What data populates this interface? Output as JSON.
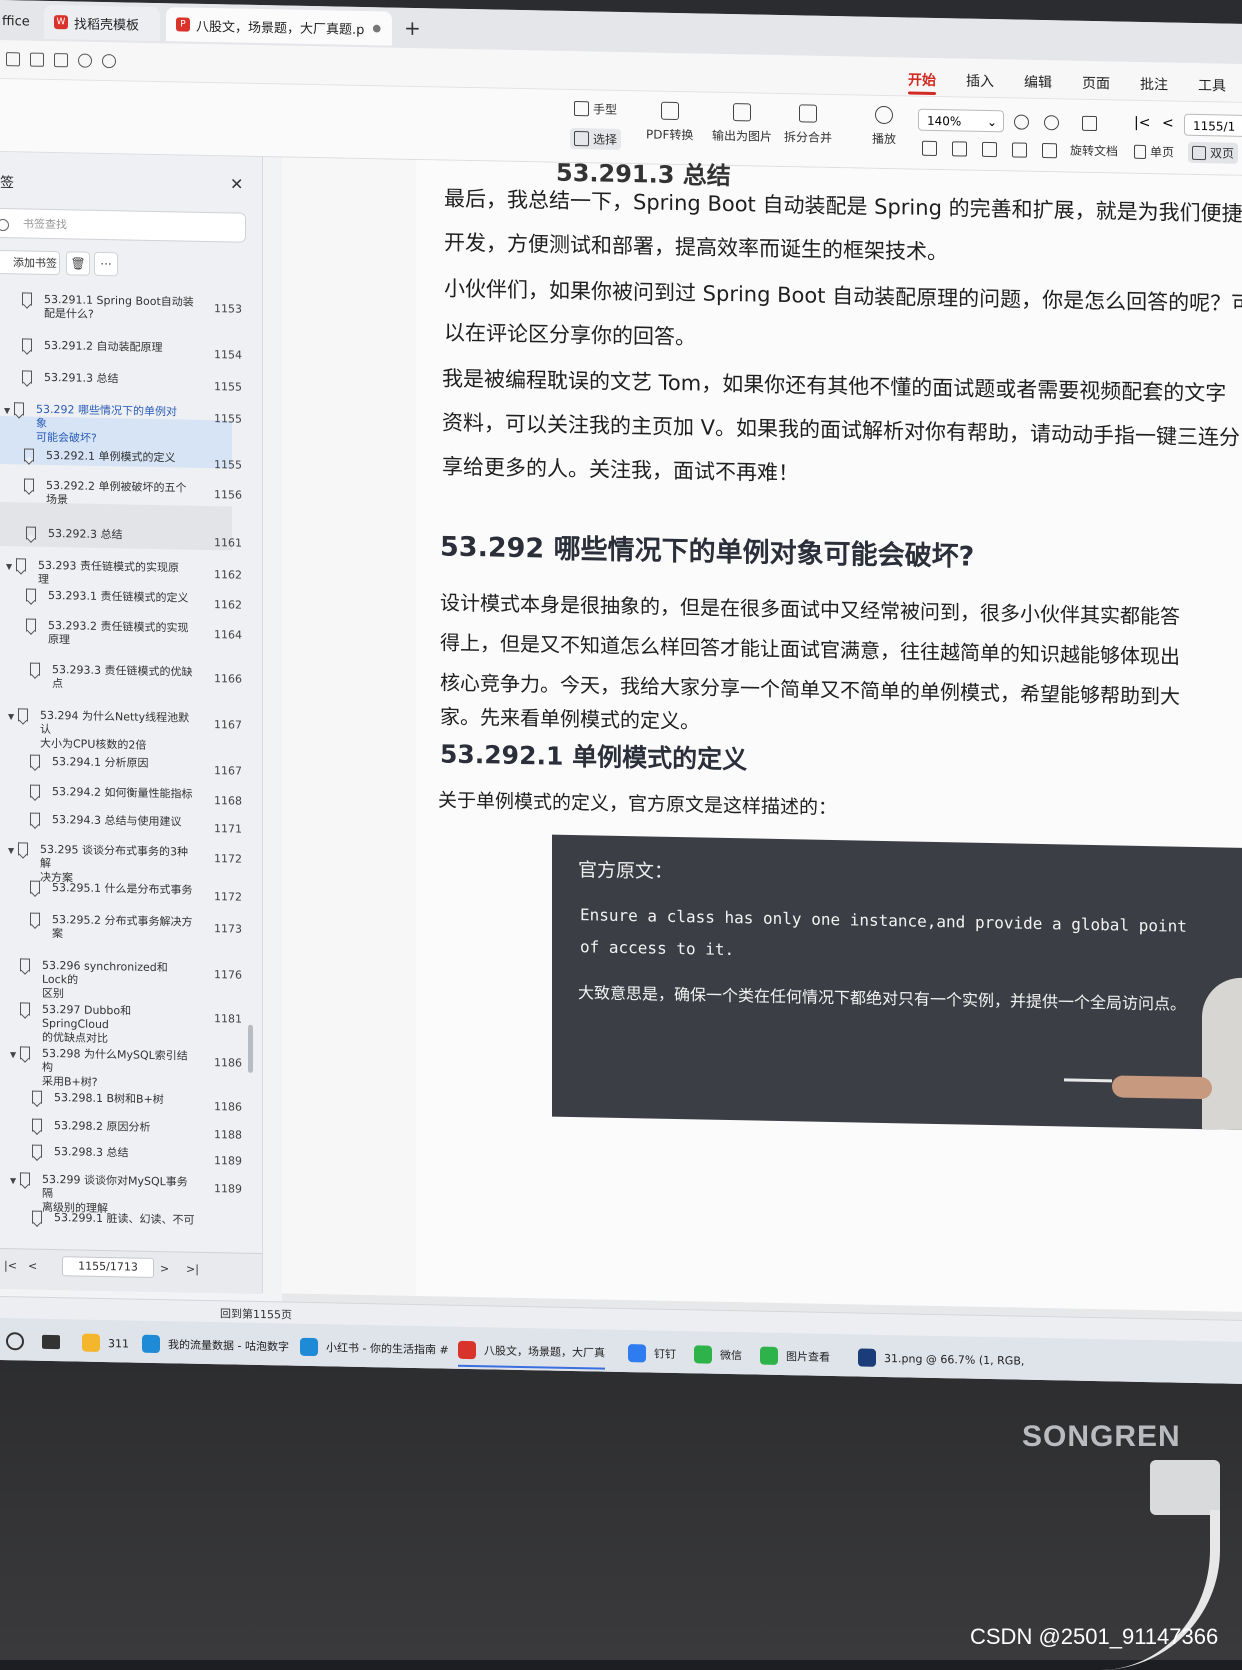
{
  "tabs": [
    {
      "label": "ffice"
    },
    {
      "label": "找稻壳模板"
    },
    {
      "label": "八股文，场景题，大厂真题.p"
    }
  ],
  "menu": [
    "开始",
    "插入",
    "编辑",
    "页面",
    "批注",
    "工具"
  ],
  "ribbon": {
    "hand": "手型",
    "select": "选择",
    "pdf_convert": "PDF转换",
    "export_image": "输出为图片",
    "split_merge": "拆分合并",
    "play": "播放",
    "zoom": "140%",
    "rotate": "旋转文档",
    "single": "单页",
    "double": "双页",
    "page_input": "1155/1"
  },
  "sidebar": {
    "title": "签",
    "search_placeholder": "书签查找",
    "add_label": "添加书签",
    "more_label": "···",
    "items": [
      {
        "text": "53.291.1 Spring Boot自动装\n配是什么?",
        "page": "1153"
      },
      {
        "text": "53.291.2 自动装配原理",
        "page": "1154"
      },
      {
        "text": "53.291.3 总结",
        "page": "1155"
      },
      {
        "text": "53.292 哪些情况下的单例对象\n可能会破坏?",
        "page": "1155"
      },
      {
        "text": "53.292.1 单例模式的定义",
        "page": "1155"
      },
      {
        "text": "53.292.2 单例被破坏的五个\n场景",
        "page": "1156"
      },
      {
        "text": "53.292.3 总结",
        "page": "1161"
      },
      {
        "text": "53.293 责任链模式的实现原理",
        "page": "1162"
      },
      {
        "text": "53.293.1 责任链模式的定义",
        "page": "1162"
      },
      {
        "text": "53.293.2 责任链模式的实现\n原理",
        "page": "1164"
      },
      {
        "text": "53.293.3 责任链模式的优缺\n点",
        "page": "1166"
      },
      {
        "text": "53.294 为什么Netty线程池默认\n大小为CPU核数的2倍",
        "page": "1167"
      },
      {
        "text": "53.294.1 分析原因",
        "page": "1167"
      },
      {
        "text": "53.294.2 如何衡量性能指标",
        "page": "1168"
      },
      {
        "text": "53.294.3 总结与使用建议",
        "page": "1171"
      },
      {
        "text": "53.295 谈谈分布式事务的3种解\n决方案",
        "page": "1172"
      },
      {
        "text": "53.295.1 什么是分布式事务",
        "page": "1172"
      },
      {
        "text": "53.295.2 分布式事务解决方\n案",
        "page": "1173"
      },
      {
        "text": "53.296 synchronized和Lock的\n区别",
        "page": "1176"
      },
      {
        "text": "53.297 Dubbo和SpringCloud\n的优缺点对比",
        "page": "1181"
      },
      {
        "text": "53.298 为什么MySQL索引结构\n采用B+树?",
        "page": "1186"
      },
      {
        "text": "53.298.1 B树和B+树",
        "page": "1186"
      },
      {
        "text": "53.298.2 原因分析",
        "page": "1188"
      },
      {
        "text": "53.298.3 总结",
        "page": "1189"
      },
      {
        "text": "53.299 谈谈你对MySQL事务隔\n离级别的理解",
        "page": "1189"
      },
      {
        "text": "53.299.1 脏读、幻读、不可",
        "page": ""
      }
    ],
    "page_indicator": "1155/1713"
  },
  "status": {
    "back": "回到第1155页"
  },
  "doc": {
    "top_cut": "53.291.3 总结",
    "p1": [
      "最后，我总结一下，Spring Boot 自动装配是 Spring 的完善和扩展，就是为我们便捷",
      "开发，方便测试和部署，提高效率而诞生的框架技术。"
    ],
    "p2": [
      "小伙伴们，如果你被问到过 Spring Boot 自动装配原理的问题，你是怎么回答的呢？可",
      "以在评论区分享你的回答。"
    ],
    "p3": [
      "我是被编程耽误的文艺 Tom，如果你还有其他不懂的面试题或者需要视频配套的文字",
      "资料，可以关注我的主页加 V。如果我的面试解析对你有帮助，请动动手指一键三连分",
      "享给更多的人。关注我，面试不再难！"
    ],
    "h2": "53.292  哪些情况下的单例对象可能会破坏?",
    "p4": [
      "设计模式本身是很抽象的，但是在很多面试中又经常被问到，很多小伙伴其实都能答",
      "得上，但是又不知道怎么样回答才能让面试官满意，往往越简单的知识越能够体现出",
      "核心竞争力。今天，我给大家分享一个简单又不简单的单例模式，希望能够帮助到大",
      "家。先来看单例模式的定义。"
    ],
    "h3": "53.292.1  单例模式的定义",
    "p5": "关于单例模式的定义，官方原文是这样描述的：",
    "quote_head": "官方原文：",
    "quote_en": [
      "Ensure a class has only one instance,and provide a global point",
      "of access to it."
    ],
    "quote_cn": "大致意思是，确保一个类在任何情况下都绝对只有一个实例，并提供一个全局访问点。"
  },
  "taskbar": [
    {
      "label": "311",
      "color": "#f3b62c"
    },
    {
      "label": "我的流量数据 - 咕泡数字",
      "color": "#1f8ad6"
    },
    {
      "label": "小红书 - 你的生活指南 #",
      "color": "#1f8ad6"
    },
    {
      "label": "八股文，场景题，大厂真",
      "color": "#d9342b"
    },
    {
      "label": "钉钉",
      "color": "#2f7bf0"
    },
    {
      "label": "微信",
      "color": "#2db34a"
    },
    {
      "label": "图片查看",
      "color": "#2db34a"
    },
    {
      "label": "31.png @ 66.7% (1, RGB,",
      "color": "#1a3d7a"
    }
  ],
  "brand": "SONGREN",
  "watermark": "CSDN @2501_91147366"
}
